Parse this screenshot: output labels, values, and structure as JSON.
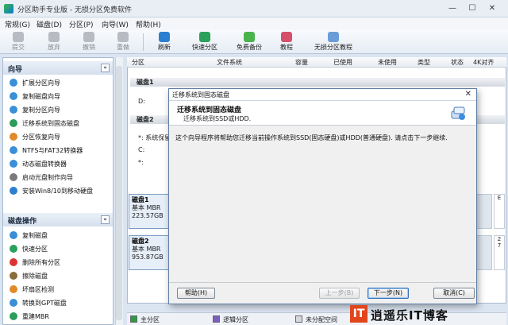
{
  "window": {
    "title": "分区助手专业版 - 无损分区免费软件",
    "minimize": "—",
    "maximize": "☐",
    "close": "✕"
  },
  "menu": [
    "常规(G)",
    "磁盘(D)",
    "分区(P)",
    "向导(W)",
    "帮助(H)"
  ],
  "toolbar": [
    {
      "label": "提交",
      "icon": "submit-icon",
      "enabled": false
    },
    {
      "label": "放弃",
      "icon": "discard-icon",
      "enabled": false
    },
    {
      "label": "撤销",
      "icon": "undo-icon",
      "enabled": false
    },
    {
      "label": "重做",
      "icon": "redo-icon",
      "enabled": false
    },
    {
      "label": "刷新",
      "icon": "refresh-icon",
      "enabled": true
    },
    {
      "label": "快速分区",
      "icon": "quick-partition-icon",
      "enabled": true
    },
    {
      "label": "免费备份",
      "icon": "backup-icon",
      "enabled": true
    },
    {
      "label": "教程",
      "icon": "tutorial-icon",
      "enabled": true
    },
    {
      "label": "无损分区教程",
      "icon": "lossless-tutorial-icon",
      "enabled": true
    }
  ],
  "sidebar": {
    "wizard_title": "向导",
    "wizard_items": [
      "扩展分区向导",
      "复制磁盘向导",
      "复制分区向导",
      "迁移系统到固态磁盘",
      "分区恢复向导",
      "NTFS与FAT32转换器",
      "动态磁盘转换器",
      "启动光盘制作向导",
      "安装Win8/10到移动硬盘"
    ],
    "disk_ops_title": "磁盘操作",
    "disk_ops_items": [
      "复制磁盘",
      "快速分区",
      "删除所有分区",
      "擦除磁盘",
      "坏扇区检测",
      "转换到GPT磁盘",
      "重建MBR"
    ],
    "collapse_glyph": "«"
  },
  "table": {
    "columns": [
      "分区",
      "文件系统",
      "容量",
      "已使用",
      "未使用",
      "类型",
      "状态",
      "4K对齐"
    ],
    "disk1_label": "磁盘1",
    "disk1_row": "D:",
    "disk2_label": "磁盘2",
    "disk2_rows": [
      "*: 系统保留",
      "C:",
      "*:"
    ]
  },
  "disk_cards": [
    {
      "name": "磁盘1",
      "kind": "基本 MBR",
      "size": "223.57GB"
    },
    {
      "name": "磁盘2",
      "kind": "基本 MBR",
      "size": "953.87GB"
    }
  ],
  "strip_right": [
    "E",
    "2",
    "7"
  ],
  "legend": [
    {
      "label": "主分区",
      "color": "#2a9d3c"
    },
    {
      "label": "逻辑分区",
      "color": "#7b5fbf"
    },
    {
      "label": "未分配空间",
      "color": "#d8d8d8"
    }
  ],
  "dialog": {
    "title": "迁移系统到固态磁盘",
    "heading": "迁移系统到固态磁盘",
    "subheading": "迁移系统到SSD或HDD.",
    "description": "这个向导程序将帮助您迁移当前操作系统到SSD(固态硬盘)或HDD(普通硬盘). 请点击下一步继续.",
    "close_glyph": "✕",
    "buttons": {
      "help": "帮助(H)",
      "back": "上一步(B)",
      "next": "下一步(N)",
      "cancel": "取消(C)"
    }
  },
  "watermark": {
    "logo": "IT",
    "text": "逍遥乐IT博客"
  }
}
